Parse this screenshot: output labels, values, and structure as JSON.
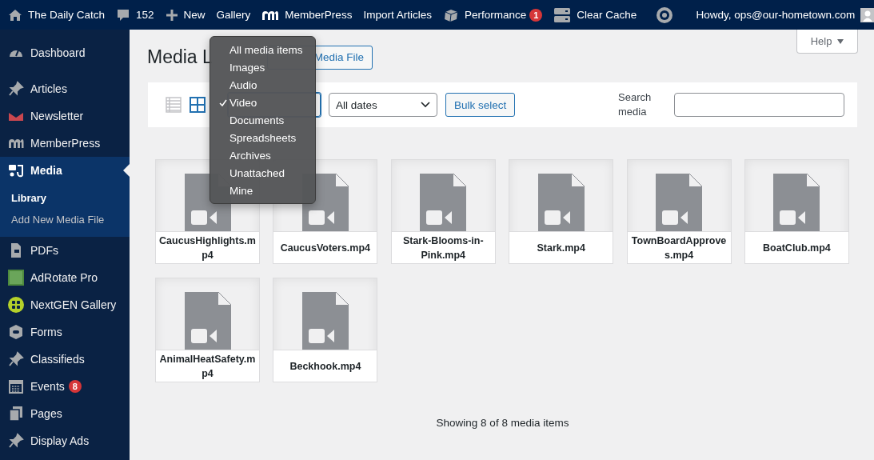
{
  "admin_bar": {
    "items": [
      {
        "label": "The Daily Catch"
      },
      {
        "label": "152"
      },
      {
        "label": "New"
      },
      {
        "label": "Gallery"
      },
      {
        "label": "MemberPress"
      },
      {
        "label": "Import Articles"
      },
      {
        "label": "Performance",
        "badge": "1"
      },
      {
        "label": "Clear Cache"
      }
    ],
    "account": "Howdy, ops@our-hometown.com"
  },
  "sidebar": {
    "items": [
      {
        "label": "Dashboard",
        "selected": false
      },
      {
        "label": "Articles",
        "selected": false
      },
      {
        "label": "Newsletter",
        "selected": false
      },
      {
        "label": "MemberPress",
        "selected": false
      },
      {
        "label": "Media",
        "selected": true,
        "children": [
          {
            "label": "Library",
            "selected": true
          },
          {
            "label": "Add New Media File",
            "selected": false
          }
        ]
      },
      {
        "label": "PDFs",
        "selected": false
      },
      {
        "label": "AdRotate Pro",
        "selected": false
      },
      {
        "label": "NextGEN Gallery",
        "selected": false
      },
      {
        "label": "Forms",
        "selected": false
      },
      {
        "label": "Classifieds",
        "selected": false
      },
      {
        "label": "Events",
        "selected": false,
        "badge": "8"
      },
      {
        "label": "Pages",
        "selected": false
      },
      {
        "label": "Display Ads",
        "selected": false
      }
    ]
  },
  "header": {
    "title": "Media L",
    "add_button": "Media File",
    "help": "Help"
  },
  "toolbar": {
    "views": [
      {
        "kind": "list",
        "selected": false
      },
      {
        "kind": "grid",
        "selected": true
      }
    ],
    "date_filter": "All dates",
    "bulk_button": "Bulk select",
    "search_label": "Search media"
  },
  "type_menu": {
    "options": [
      {
        "label": "All media items",
        "selected": false
      },
      {
        "label": "Images",
        "selected": false
      },
      {
        "label": "Audio",
        "selected": false
      },
      {
        "label": "Video",
        "selected": true
      },
      {
        "label": "Documents",
        "selected": false
      },
      {
        "label": "Spreadsheets",
        "selected": false
      },
      {
        "label": "Archives",
        "selected": false
      },
      {
        "label": "Unattached",
        "selected": false
      },
      {
        "label": "Mine",
        "selected": false
      }
    ]
  },
  "media": [
    {
      "filename": "CaucusHighlights.mp4"
    },
    {
      "filename": "CaucusVoters.mp4"
    },
    {
      "filename": "Stark-Blooms-in-Pink.mp4"
    },
    {
      "filename": "Stark.mp4"
    },
    {
      "filename": "TownBoardApproves.mp4"
    },
    {
      "filename": "BoatClub.mp4"
    },
    {
      "filename": "AnimalHeatSafety.mp4"
    },
    {
      "filename": "Beckhook.mp4"
    }
  ],
  "status": "Showing 8 of 8 media items"
}
